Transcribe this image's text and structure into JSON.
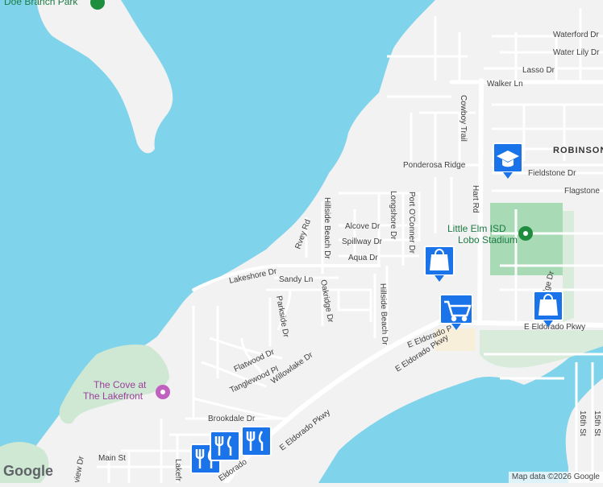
{
  "map": {
    "labels": {
      "doe_branch_park": "Doe Branch Park",
      "waterford_dr": "Waterford Dr",
      "water_lily_dr": "Water Lily Dr",
      "lasso_dr": "Lasso Dr",
      "walker_ln": "Walker Ln",
      "cowboy_trail": "Cowboy Trail",
      "robinson_ridge": "ROBINSON RIDGE",
      "ponderosa_ridge": "Ponderosa Ridge",
      "fieldstone_dr": "Fieldstone Dr",
      "flagstone": "Flagstone",
      "hart_rd": "Hart Rd",
      "longshore_dr": "Longshore Dr",
      "port_oconner_dr": "Port O'Conner Dr",
      "alcove_dr": "Alcove Dr",
      "spillway_dr": "Spillway Dr",
      "aqua_dr": "Aqua Dr",
      "rivey_rd": "Rvey Rd",
      "hillside_beach_dr": "Hillside Beach Dr",
      "lakeshore_dr": "Lakeshore Dr",
      "sandy_ln": "Sandy Ln",
      "oakridge_dr": "Oakridge Dr",
      "parkside_dr": "Parkside Dr",
      "flatwood_dr": "Flatwood Dr",
      "tanglewood_pl": "Tanglewood Pl",
      "willowlake_dr": "Willowlake Dr",
      "e_eldorado_pkwy": "E Eldorado Pkwy",
      "e_eldorado_p": "E Eldorado P",
      "brookdale_dr": "Brookdale Dr",
      "main_st": "Main St",
      "eldorado": "Eldorado",
      "view_dr": "view Dr",
      "lakefront": "Lakefr",
      "oakridge_dr_2": "ridge Dr",
      "sixteenth_st": "16th St",
      "fifteenth_st": "15th St",
      "little_elm_isd_line1": "Little Elm ISD",
      "little_elm_isd_line2": "Lobo Stadium",
      "cove_line1": "The Cove at",
      "cove_line2": "The Lakefront"
    },
    "icons": {
      "school": "school-cap-icon",
      "shopping": "shopping-bag-icon",
      "cart": "shopping-cart-icon",
      "restaurant": "fork-knife-icon",
      "park": "park-icon"
    },
    "colors": {
      "water": "#7fd3ea",
      "land": "#f2f2f2",
      "park": "#a8dab5",
      "road": "#ffffff",
      "marker": "#1a73e8"
    }
  },
  "footer": {
    "logo": "Google",
    "attribution": "Map data ©2026 Google"
  }
}
